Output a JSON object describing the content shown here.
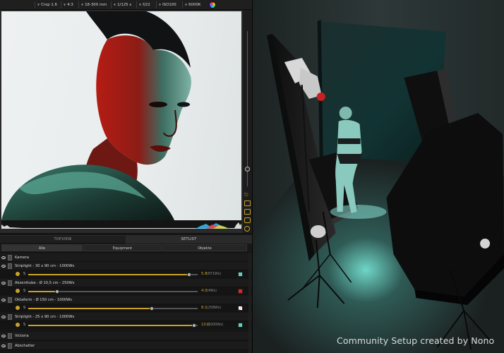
{
  "toolbar": {
    "crop": "Crop 1.6",
    "aspect": "4:3",
    "lens": "18-300 mm",
    "shutter": "1/125 s",
    "aperture": "f/22",
    "iso": "ISO100",
    "white_balance": "6000K"
  },
  "tabs": {
    "topview": "TOPVIEW",
    "setlist": "SETLIST"
  },
  "filters": {
    "all": "Alle",
    "equipment": "Equipment",
    "objects": "Objekte"
  },
  "setlist": [
    {
      "label": "Kamera",
      "has_slider": false
    },
    {
      "label": "Striplight - 30 x 90 cm - 1000Ws",
      "has_slider": true,
      "power": "5.8",
      "watts": "(871Ws)",
      "fraction": 0.95,
      "color": "#5fd3c0"
    },
    {
      "label": "Akzenttube - Ø 10,5 cm - 250Ws",
      "has_slider": true,
      "power": "4.0",
      "watts": "(4Ws)",
      "fraction": 0.17,
      "color": "#e02424"
    },
    {
      "label": "Oktaform - Ø 150 cm - 1000Ws",
      "has_slider": true,
      "power": "8.1",
      "watts": "(258Ws)",
      "fraction": 0.73,
      "color": "#ffffff"
    },
    {
      "label": "Striplight - 25 x 90 cm - 1000Ws",
      "has_slider": true,
      "power": "10.0",
      "watts": "(1000Ws)",
      "fraction": 0.98,
      "color": "#5fd3c0"
    },
    {
      "label": "Victoria",
      "has_slider": false
    },
    {
      "label": "Abschatter",
      "has_slider": false
    }
  ],
  "sub_label": "S",
  "credit": "Community Setup created by Nono"
}
